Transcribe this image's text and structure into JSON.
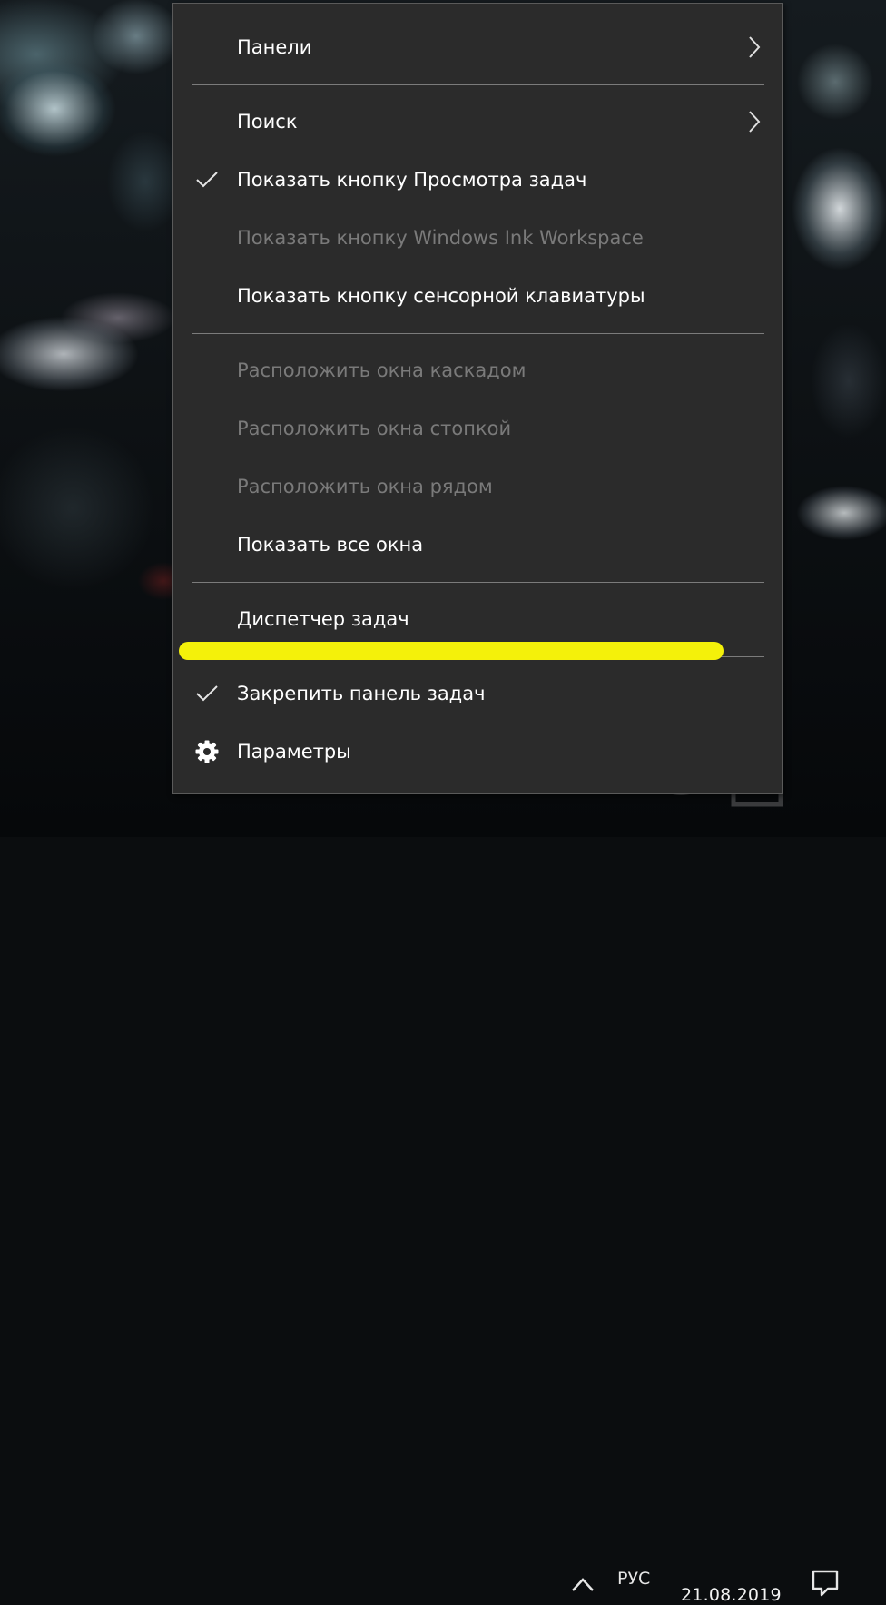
{
  "menu": {
    "items": [
      {
        "label": "Панели",
        "enabled": true,
        "submenu": true
      },
      {
        "label": "Поиск",
        "enabled": true,
        "submenu": true
      },
      {
        "label": "Показать кнопку Просмотра задач",
        "enabled": true,
        "checked": true
      },
      {
        "label": "Показать кнопку Windows Ink Workspace",
        "enabled": false
      },
      {
        "label": "Показать кнопку сенсорной клавиатуры",
        "enabled": true
      },
      {
        "label": "Расположить окна каскадом",
        "enabled": false
      },
      {
        "label": "Расположить окна стопкой",
        "enabled": false
      },
      {
        "label": "Расположить окна рядом",
        "enabled": false
      },
      {
        "label": "Показать все окна",
        "enabled": true
      },
      {
        "label": "Диспетчер задач",
        "enabled": true,
        "highlighted": true
      },
      {
        "label": "Закрепить панель задач",
        "enabled": true,
        "checked": true
      },
      {
        "label": "Параметры",
        "enabled": true,
        "icon": "gear-icon"
      }
    ]
  },
  "taskbar": {
    "language": "РУС",
    "date": "21.08.2019"
  },
  "colors": {
    "menu_background": "#2b2b2b",
    "menu_text": "#ffffff",
    "disabled_text": "#7a7a7a",
    "separator": "#7b7b7b",
    "highlight_marker": "#f4f10a"
  }
}
